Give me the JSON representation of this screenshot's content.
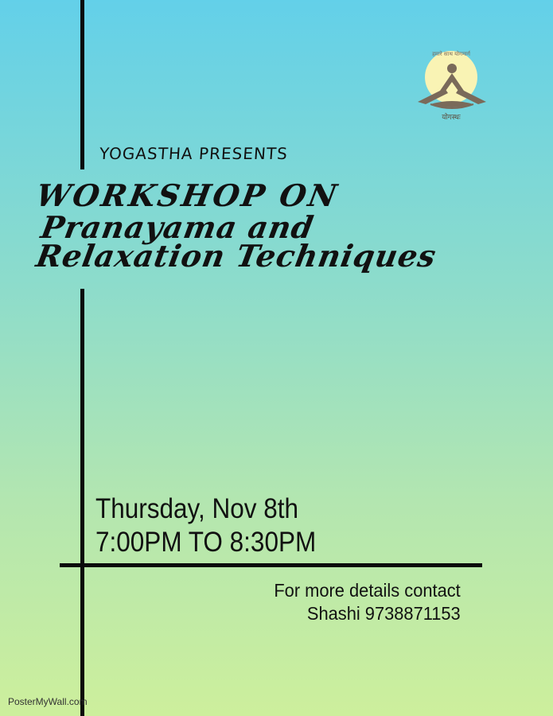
{
  "logo": {
    "top_text": "हमारे साथ योगमार्ग",
    "bottom_text": "योगस्थः",
    "icon": "meditating-figure-sun-icon",
    "colors": {
      "sun": "#f9f3b4",
      "figure": "#7a6a5a"
    }
  },
  "header": {
    "presents": "YOGASTHA PRESENTS"
  },
  "title": {
    "line1": "WORKSHOP ON",
    "line2": "Pranayama and",
    "line3": "Relaxation Techniques"
  },
  "schedule": {
    "date": "Thursday, Nov 8th",
    "time": "7:00PM TO 8:30PM"
  },
  "contact": {
    "line1": "For more details contact",
    "line2": "Shashi 9738871153"
  },
  "watermark": "PosterMyWall.com",
  "colors": {
    "gradient_top": "#63d0e9",
    "gradient_bottom": "#cdef9c",
    "ink": "#0b0b0b"
  }
}
